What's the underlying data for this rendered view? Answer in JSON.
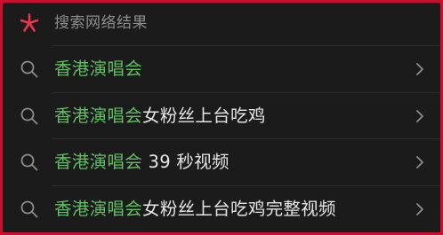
{
  "header": {
    "title": "搜索网络结果",
    "logo_icon": "asterisk-brand-icon"
  },
  "colors": {
    "frame": "#c8102e",
    "background": "#1b1b1b",
    "highlight": "#5fbf63",
    "text": "#e6e6e6",
    "muted": "#8d8d8d",
    "logo": "#e8374a"
  },
  "results": [
    {
      "query_highlight": "香港演唱会",
      "rest": ""
    },
    {
      "query_highlight": "香港演唱会",
      "rest": "女粉丝上台吃鸡"
    },
    {
      "query_highlight": "香港演唱会",
      "rest": " 39 秒视频"
    },
    {
      "query_highlight": "香港演唱会",
      "rest": "女粉丝上台吃鸡完整视频"
    }
  ]
}
